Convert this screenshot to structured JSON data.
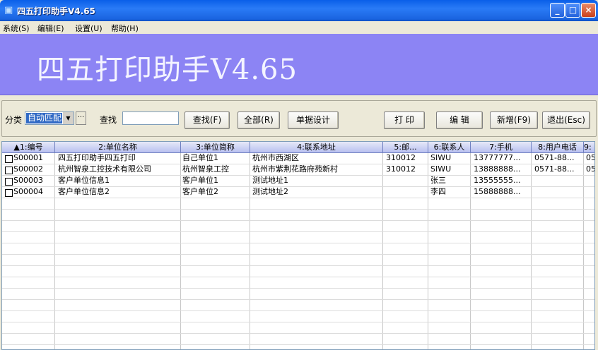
{
  "window": {
    "title": "四五打印助手V4.65",
    "minimize": "_",
    "maximize": "□",
    "close": "×"
  },
  "menu": [
    "系统(S)",
    "编辑(E)",
    "设置(U)",
    "帮助(H)"
  ],
  "banner": {
    "title": "四五打印助手V4.65",
    "color": "#8c84f4"
  },
  "toolbar": {
    "category_label": "分类",
    "category_value": "自动匹配",
    "ellipsis": "···",
    "search_label": "查找",
    "search_value": "",
    "buttons": [
      "查找(F)",
      "全部(R)",
      "单据设计",
      "打 印",
      "编 辑",
      "新增(F9)",
      "退出(Esc)"
    ]
  },
  "table": {
    "columns": [
      "▲1:编号",
      "2:单位名称",
      "3:单位简称",
      "4:联系地址",
      "5:邮...",
      "6:联系人",
      "7:手机",
      "8:用户电话",
      "9:"
    ],
    "rows": [
      [
        "S00001",
        "四五打印助手四五打印",
        "自己单位1",
        "杭州市西湖区",
        "310012",
        "SIWU",
        "13777777...",
        "0571-88...",
        "05"
      ],
      [
        "S00002",
        "杭州智泉工控技术有限公司",
        "杭州智泉工控",
        "杭州市紫荆花路府苑新村",
        "310012",
        "SIWU",
        "13888888...",
        "0571-88...",
        "05"
      ],
      [
        "S00003",
        "客户单位信息1",
        "客户单位1",
        "测试地址1",
        "",
        "张三",
        "13555555...",
        "",
        ""
      ],
      [
        "S00004",
        "客户单位信息2",
        "客户单位2",
        "测试地址2",
        "",
        "李四",
        "15888888...",
        "",
        ""
      ]
    ]
  }
}
